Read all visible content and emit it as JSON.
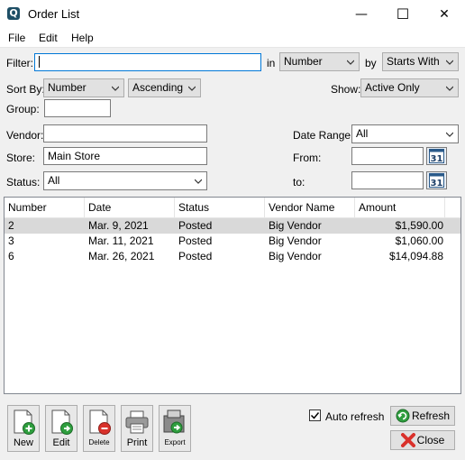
{
  "window": {
    "title": "Order List",
    "app_icon_glyph": "Q",
    "controls": {
      "minimize": "—",
      "maximize": "☐",
      "close": "✕"
    }
  },
  "menu": {
    "items": [
      "File",
      "Edit",
      "Help"
    ]
  },
  "filter": {
    "label": "Filter:",
    "value": "",
    "in_label": "in",
    "field_value": "Number",
    "by_label": "by",
    "mode_value": "Starts With"
  },
  "sort": {
    "label": "Sort By:",
    "field_value": "Number",
    "order_value": "Ascending"
  },
  "show": {
    "label": "Show:",
    "value": "Active Only"
  },
  "group": {
    "label": "Group:",
    "value": ""
  },
  "vendor": {
    "label": "Vendor:",
    "value": ""
  },
  "store": {
    "label": "Store:",
    "value": "Main Store"
  },
  "status_filter": {
    "label": "Status:",
    "value": "All"
  },
  "date_range": {
    "label": "Date Range:",
    "value": "All",
    "from_label": "From:",
    "from_value": "",
    "to_label": "to:",
    "to_value": "",
    "calendar_glyph": "31"
  },
  "table": {
    "columns": [
      "Number",
      "Date",
      "Status",
      "Vendor Name",
      "Amount"
    ],
    "rows": [
      {
        "number": "2",
        "date": "Mar. 9, 2021",
        "status": "Posted",
        "vendor": "Big Vendor",
        "amount": "$1,590.00",
        "selected": true
      },
      {
        "number": "3",
        "date": "Mar. 11, 2021",
        "status": "Posted",
        "vendor": "Big Vendor",
        "amount": "$1,060.00",
        "selected": false
      },
      {
        "number": "6",
        "date": "Mar. 26, 2021",
        "status": "Posted",
        "vendor": "Big Vendor",
        "amount": "$14,094.88",
        "selected": false
      }
    ]
  },
  "toolbar": {
    "new_label": "New",
    "edit_label": "Edit",
    "delete_label": "Delete",
    "print_label": "Print",
    "export_label": "Export"
  },
  "auto_refresh": {
    "label": "Auto refresh",
    "checked": true
  },
  "buttons": {
    "refresh_label": "Refresh",
    "close_label": "Close"
  },
  "colors": {
    "selection": "#d9d9d9",
    "focus_border": "#0078d7",
    "accent_green": "#2e9e3e",
    "accent_red": "#d9312b"
  }
}
